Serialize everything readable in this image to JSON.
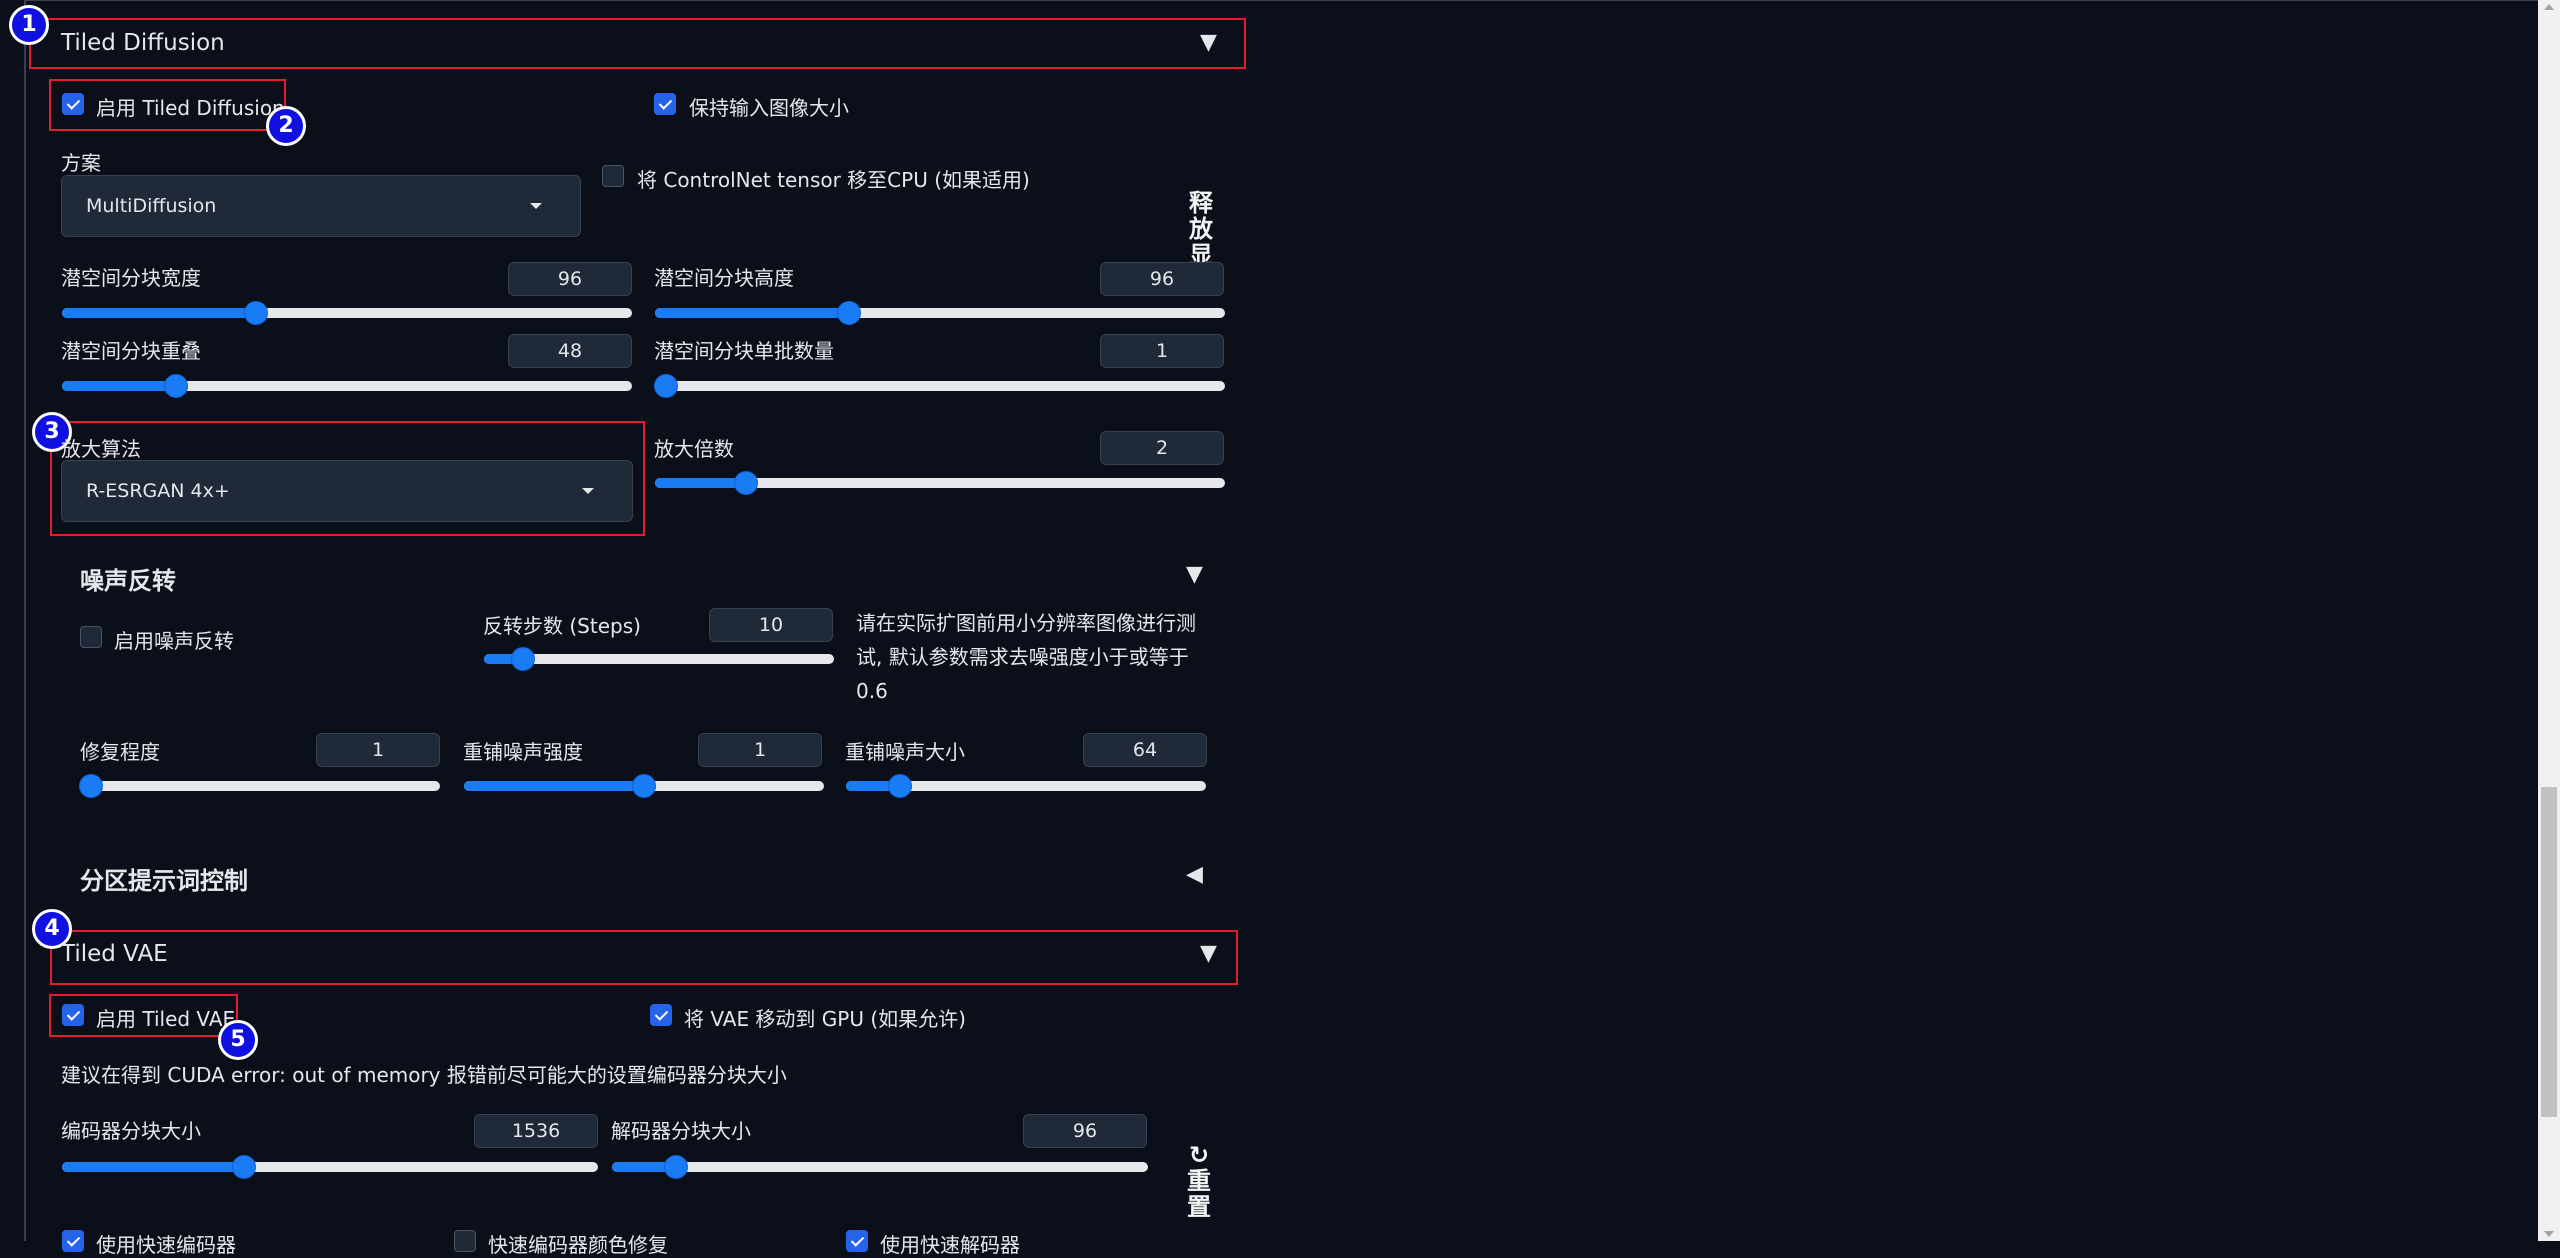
{
  "tiled_diffusion": {
    "title": "Tiled Diffusion",
    "enable_label": "启用 Tiled Diffusion",
    "enable_checked": true,
    "keep_size_label": "保持输入图像大小",
    "keep_size_checked": true,
    "method_label": "方案",
    "method_value": "MultiDiffusion",
    "controlnet_cpu_label": "将 ControlNet tensor 移至CPU (如果适用)",
    "controlnet_cpu_checked": false,
    "free_vram_label": "释放显",
    "tile_width": {
      "label": "潜空间分块宽度",
      "value": "96",
      "fraction": 0.34
    },
    "tile_height": {
      "label": "潜空间分块高度",
      "value": "96",
      "fraction": 0.34
    },
    "tile_overlap": {
      "label": "潜空间分块重叠",
      "value": "48",
      "fraction": 0.2
    },
    "tile_batch": {
      "label": "潜空间分块单批数量",
      "value": "1",
      "fraction": 0.02
    },
    "upscaler_label": "放大算法",
    "upscaler_value": "R-ESRGAN 4x+",
    "scale": {
      "label": "放大倍数",
      "value": "2",
      "fraction": 0.16
    }
  },
  "noise_inversion": {
    "title": "噪声反转",
    "enable_label": "启用噪声反转",
    "enable_checked": false,
    "steps": {
      "label": "反转步数 (Steps)",
      "value": "10",
      "fraction": 0.11
    },
    "note": "请在实际扩图前用小分辨率图像进行测试, 默认参数需求去噪强度小于或等于0.6",
    "retouch": {
      "label": "修复程度",
      "value": "1",
      "fraction": 0.03
    },
    "renoise_strength": {
      "label": "重铺噪声强度",
      "value": "1",
      "fraction": 0.5
    },
    "renoise_size": {
      "label": "重铺噪声大小",
      "value": "64",
      "fraction": 0.15
    }
  },
  "region_prompt": {
    "title": "分区提示词控制"
  },
  "tiled_vae": {
    "title": "Tiled VAE",
    "enable_label": "启用 Tiled VAE",
    "enable_checked": true,
    "gpu_label": "将 VAE 移动到 GPU (如果允许)",
    "gpu_checked": true,
    "hint": "建议在得到 CUDA error: out of memory 报错前尽可能大的设置编码器分块大小",
    "encoder": {
      "label": "编码器分块大小",
      "value": "1536",
      "fraction": 0.34
    },
    "decoder": {
      "label": "解码器分块大小",
      "value": "96",
      "fraction": 0.12
    },
    "reset_label": "↻重置",
    "fast_encoder_label": "使用快速编码器",
    "fast_encoder_checked": true,
    "color_fix_label": "快速编码器颜色修复",
    "color_fix_checked": false,
    "fast_decoder_label": "使用快速解码器",
    "fast_decoder_checked": true
  },
  "badges": [
    "1",
    "2",
    "3",
    "4",
    "5"
  ]
}
